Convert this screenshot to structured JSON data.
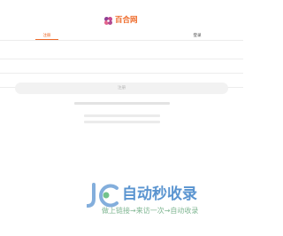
{
  "brand": {
    "name": "百合网",
    "accent": "#ee6b2b",
    "logo_colors": [
      "#8e3f93",
      "#c64a8f",
      "#e2648c"
    ]
  },
  "tabs": [
    {
      "label": "注册",
      "active": true
    },
    {
      "label": "登录",
      "active": false
    }
  ],
  "form": {
    "fields": [
      {
        "value": "",
        "placeholder": ""
      },
      {
        "value": "",
        "placeholder": ""
      },
      {
        "value": "",
        "placeholder": ""
      }
    ],
    "submit_label": "注册"
  },
  "watermark": {
    "icon": "jc-logo-mark",
    "title": "自动秒收录",
    "subtitle": "做上链接→来访一次→自动收录"
  }
}
